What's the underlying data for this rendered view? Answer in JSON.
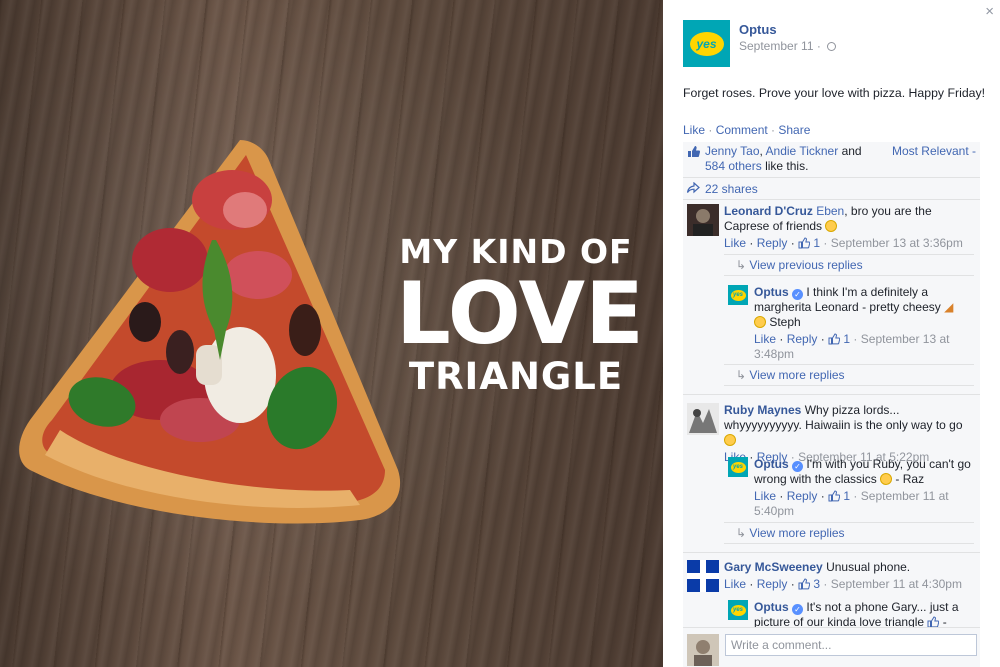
{
  "photo": {
    "headline_line1": "MY KIND OF",
    "headline_line2": "LOVE",
    "headline_line3": "TRIANGLE"
  },
  "post": {
    "close_glyph": "×",
    "page_name": "Optus",
    "logo_text": "yes",
    "date": "September 11 ·",
    "text": "Forget roses. Prove your love with pizza. Happy Friday!",
    "actions": {
      "like": "Like",
      "comment": "Comment",
      "share": "Share",
      "sep": " · "
    },
    "likes": {
      "name1": "Jenny Tao",
      "name2": "Andie Tickner",
      "and": "and",
      "others": "584 others",
      "suffix": "like this.",
      "sort": "Most Relevant -"
    },
    "shares": "22 shares"
  },
  "comments": [
    {
      "author": "Leonard D'Cruz",
      "tag": "Eben",
      "text_part1": ", bro you are the Caprese of friends",
      "like": "Like",
      "reply": "Reply",
      "count": "1",
      "time": "September 13 at 3:36pm",
      "previous_replies": "View previous replies",
      "reply_author": "Optus",
      "reply_text1": "I think I'm a definitely a margherita Leonard - pretty cheesy",
      "reply_text2": "Steph",
      "reply_count": "1",
      "reply_time": "September 13 at 3:48pm",
      "more_replies": "View more replies"
    },
    {
      "author": "Ruby Maynes",
      "text": "Why pizza lords... whyyyyyyyyyy. Haiwaiin is the only way to go",
      "like": "Like",
      "reply": "Reply",
      "time": "September 11 at 5:22pm",
      "reply_author": "Optus",
      "reply_text1": "I'm with you Ruby, you can't go wrong with the classics",
      "reply_text2": "- Raz",
      "reply_count": "1",
      "reply_time": "September 11 at 5:40pm",
      "more_replies": "View more replies"
    },
    {
      "author": "Gary McSweeney",
      "text": "Unusual phone.",
      "like": "Like",
      "reply": "Reply",
      "count": "3",
      "time": "September 11 at 4:30pm",
      "reply_author": "Optus",
      "reply_text1": "It's not a phone Gary... just a picture of our kinda love triangle",
      "reply_text2": "-"
    }
  ],
  "composer": {
    "placeholder": "Write a comment..."
  },
  "colors": {
    "link": "#365899",
    "optus_teal": "#00a6b5",
    "optus_yellow": "#ffd500"
  }
}
